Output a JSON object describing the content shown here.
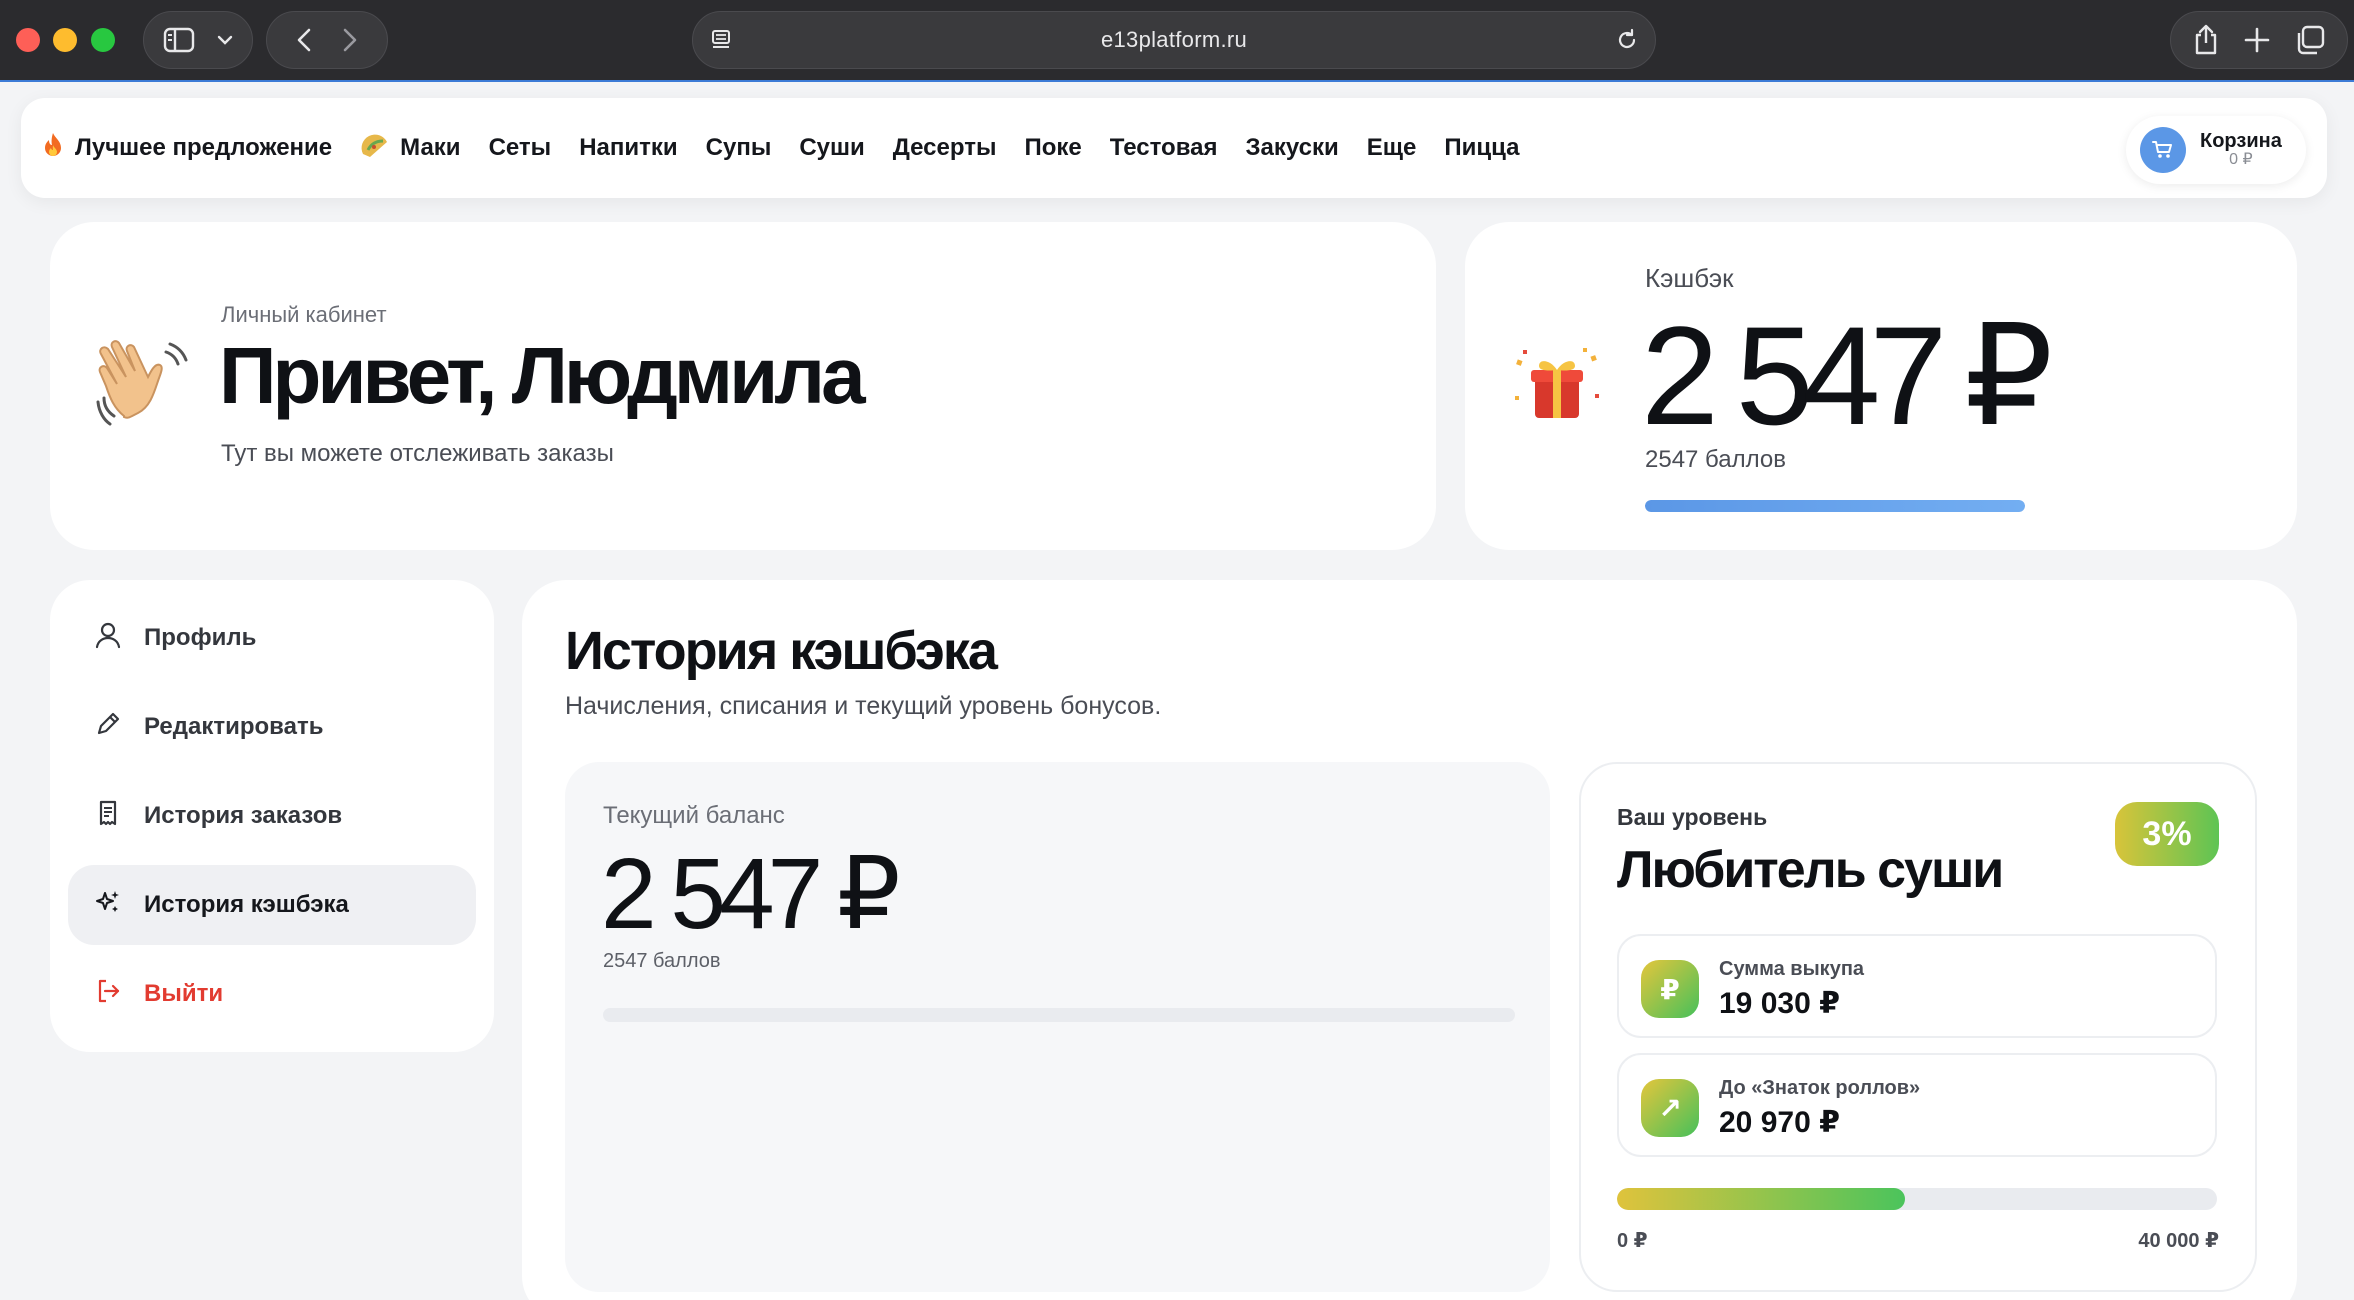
{
  "browser": {
    "url": "e13platform.ru"
  },
  "nav": {
    "items": [
      {
        "label": "Лучшее предложение",
        "icon": "fire-icon"
      },
      {
        "label": "Маки",
        "icon": "taco-icon"
      },
      {
        "label": "Сеты"
      },
      {
        "label": "Напитки"
      },
      {
        "label": "Супы"
      },
      {
        "label": "Суши"
      },
      {
        "label": "Десерты"
      },
      {
        "label": "Поке"
      },
      {
        "label": "Тестовая"
      },
      {
        "label": "Закуски"
      },
      {
        "label": "Еще"
      },
      {
        "label": "Пицца"
      }
    ],
    "cart": {
      "label": "Корзина",
      "sum": "0 ₽"
    }
  },
  "greeting": {
    "kicker": "Личный кабинет",
    "title": "Привет, Людмила",
    "subtitle": "Тут вы можете отслеживать заказы"
  },
  "cashback": {
    "label": "Кэшбэк",
    "value": "2 547 ₽",
    "points": "2547 баллов",
    "progress_fraction": 1.0
  },
  "sidebar": {
    "items": [
      {
        "label": "Профиль",
        "icon": "user-icon"
      },
      {
        "label": "Редактировать",
        "icon": "pencil-icon"
      },
      {
        "label": "История заказов",
        "icon": "receipt-icon"
      },
      {
        "label": "История кэшбэка",
        "icon": "sparkle-icon",
        "active": true
      },
      {
        "label": "Выйти",
        "icon": "logout-icon"
      }
    ]
  },
  "history": {
    "title": "История кэшбэка",
    "subtitle": "Начисления, списания и текущий уровень бонусов.",
    "balance": {
      "label": "Текущий баланс",
      "value": "2 547 ₽",
      "points": "2547 баллов",
      "progress_fraction": 0
    },
    "level": {
      "kicker": "Ваш уровень",
      "title": "Любитель суши",
      "percent": "3%",
      "stats": [
        {
          "label": "Сумма выкупа",
          "value": "19 030 ₽",
          "icon": "ruble-icon",
          "glyph": "₽"
        },
        {
          "label": "До «Знаток роллов»",
          "value": "20 970 ₽",
          "icon": "arrow-up-right-icon",
          "glyph": "↗"
        }
      ],
      "progress_fraction": 0.48,
      "min": "0 ₽",
      "max": "40 000 ₽"
    }
  },
  "colors": {
    "accent": "#5b97e6",
    "logout": "#e23b30",
    "level_gradient_start": "#dfc33c",
    "level_gradient_end": "#4bc45c"
  }
}
